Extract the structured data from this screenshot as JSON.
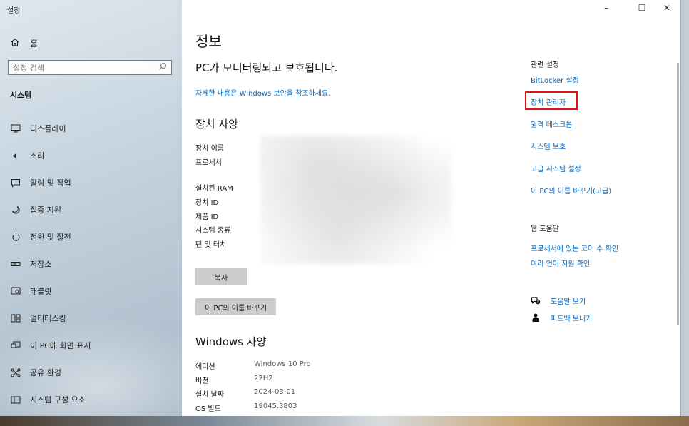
{
  "window": {
    "title": "설정",
    "controls": {
      "minimize": "–",
      "maximize": "☐",
      "close": "✕"
    }
  },
  "sidebar": {
    "home": {
      "icon": "home-icon",
      "label": "홈"
    },
    "search": {
      "placeholder": "설정 검색",
      "icon": "search-icon"
    },
    "section": "시스템",
    "items": [
      {
        "icon": "display-icon",
        "label": "디스플레이"
      },
      {
        "icon": "sound-icon",
        "label": "소리"
      },
      {
        "icon": "notification-icon",
        "label": "알림 및 작업"
      },
      {
        "icon": "focus-assist-icon",
        "label": "집중 지원"
      },
      {
        "icon": "power-icon",
        "label": "전원 및 절전"
      },
      {
        "icon": "storage-icon",
        "label": "저장소"
      },
      {
        "icon": "tablet-icon",
        "label": "태블릿"
      },
      {
        "icon": "multitasking-icon",
        "label": "멀티태스킹"
      },
      {
        "icon": "projecting-icon",
        "label": "이 PC에 화면 표시"
      },
      {
        "icon": "shared-experiences-icon",
        "label": "공유 환경"
      },
      {
        "icon": "system-components-icon",
        "label": "시스템 구성 요소"
      }
    ]
  },
  "main": {
    "title": "정보",
    "protection": "PC가 모니터링되고 보호됩니다.",
    "details_link": "자세한 내용은 Windows 보안을 참조하세요.",
    "device_specs": {
      "heading": "장치 사양",
      "labels": [
        "장치 이름",
        "프로세서",
        "설치된 RAM",
        "장치 ID",
        "제품 ID",
        "시스템 종류",
        "펜 및 터치"
      ]
    },
    "copy_button": "복사",
    "rename_button": "이 PC의 이름 바꾸기",
    "windows_specs": {
      "heading": "Windows 사양",
      "rows": [
        {
          "label": "에디션",
          "value": "Windows 10 Pro"
        },
        {
          "label": "버전",
          "value": "22H2"
        },
        {
          "label": "설치 날짜",
          "value": "2024-03-01"
        },
        {
          "label": "OS 빌드",
          "value": "19045.3803"
        }
      ]
    }
  },
  "related": {
    "heading": "관련 설정",
    "links": [
      "BitLocker 설정",
      "장치 관리자",
      "원격 데스크톱",
      "시스템 보호",
      "고급 시스템 설정",
      "이 PC의 이름 바꾸기(고급)"
    ],
    "highlighted": "장치 관리자"
  },
  "web_help": {
    "heading": "웹 도움말",
    "links": [
      "프로세서에 있는 코어 수 확인",
      "여러 언어 지원 확인"
    ]
  },
  "help": {
    "get_help": {
      "icon": "get-help-icon",
      "label": "도움말 보기"
    },
    "feedback": {
      "icon": "feedback-icon",
      "label": "피드백 보내기"
    }
  },
  "colors": {
    "accent": "#0067c0",
    "highlight": "#e01010"
  }
}
